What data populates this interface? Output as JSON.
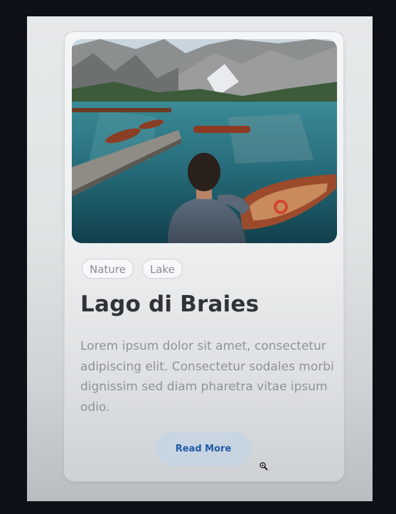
{
  "card": {
    "tags": [
      "Nature",
      "Lake"
    ],
    "title": "Lago di Braies",
    "description": "Lorem ipsum dolor sit amet, consectetur adipiscing elit. Consectetur sodales morbi dignissim sed diam pharetra vitae ipsum odio.",
    "button_label": "Read More",
    "image_icon": "lake-photo"
  },
  "colors": {
    "page_background": "#0d1117",
    "button_background": "#c7d4e2",
    "button_text": "#1f5aa8",
    "title_text": "#2f3438",
    "body_text": "#8f9397"
  },
  "cursor_icon": "zoom-in-cursor"
}
